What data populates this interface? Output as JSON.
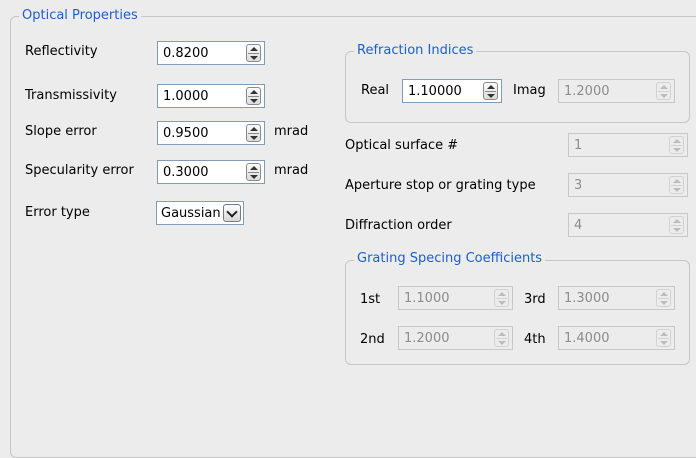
{
  "optical": {
    "title": "Optical Properties",
    "reflectivity": {
      "label": "Reflectivity",
      "value": "0.8200"
    },
    "transmissivity": {
      "label": "Transmissivity",
      "value": "1.0000"
    },
    "slope_error": {
      "label": "Slope error",
      "value": "0.9500",
      "unit": "mrad"
    },
    "specularity_error": {
      "label": "Specularity error",
      "value": "0.3000",
      "unit": "mrad"
    },
    "error_type": {
      "label": "Error type",
      "value": "Gaussian"
    }
  },
  "refraction": {
    "title": "Refraction Indices",
    "real": {
      "label": "Real",
      "value": "1.10000"
    },
    "imag": {
      "label": "Imag",
      "value": "1.2000"
    }
  },
  "surface": {
    "optical_surface": {
      "label": "Optical surface #",
      "value": "1"
    },
    "aperture_stop": {
      "label": "Aperture stop or grating type",
      "value": "3"
    },
    "diffraction_order": {
      "label": "Diffraction order",
      "value": "4"
    }
  },
  "grating": {
    "title": "Grating Specing Coefficients",
    "first": {
      "label": "1st",
      "value": "1.1000"
    },
    "second": {
      "label": "2nd",
      "value": "1.2000"
    },
    "third": {
      "label": "3rd",
      "value": "1.3000"
    },
    "fourth": {
      "label": "4th",
      "value": "1.4000"
    }
  },
  "icons": {
    "spin": "spin-up-down-icon",
    "combo": "chevron-down-icon"
  }
}
